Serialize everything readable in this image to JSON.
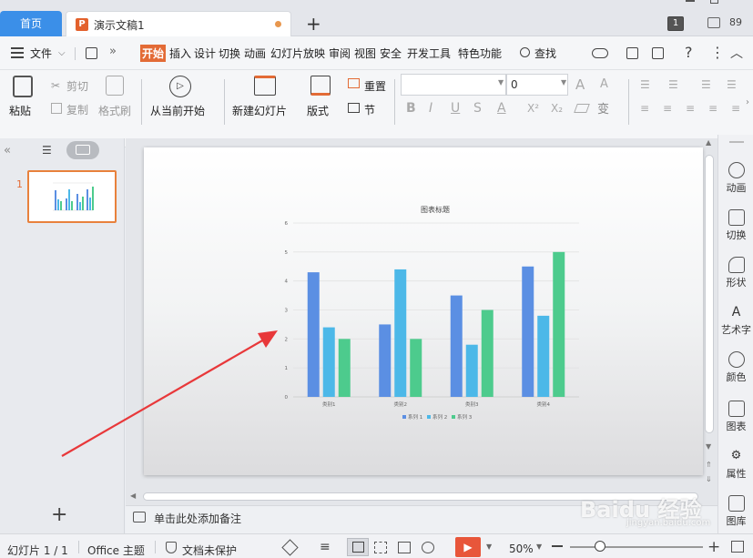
{
  "tabs": {
    "home": "首页",
    "doc": "演示文稿1",
    "new_tab": "+",
    "badge": "1",
    "count": "89"
  },
  "menu": {
    "file": "文件",
    "items": [
      "开始",
      "插入",
      "设计",
      "切换",
      "动画",
      "幻灯片放映",
      "审阅",
      "视图",
      "安全",
      "开发工具",
      "特色功能"
    ],
    "search": "查找"
  },
  "ribbon": {
    "paste": "粘贴",
    "cut": "剪切",
    "copy": "复制",
    "format_painter": "格式刷",
    "play_from_current": "从当前开始",
    "new_slide": "新建幻灯片",
    "layout": "版式",
    "reset": "重置",
    "section": "节",
    "font_size": "0"
  },
  "slides_panel": {
    "slide_number": "1"
  },
  "notes_placeholder": "单击此处添加备注",
  "right_panel": [
    "动画",
    "切换",
    "形状",
    "艺术字",
    "颜色",
    "图表",
    "属性",
    "图库"
  ],
  "status": {
    "slide_info": "幻灯片 1 / 1",
    "theme": "Office 主题",
    "protection": "文档未保护",
    "zoom": "50%"
  },
  "watermark": {
    "brand": "Baidu 经验",
    "url": "jingyan.baidu.com"
  },
  "colors": {
    "accent_orange": "#e36b36",
    "tab_blue": "#3b8fe8",
    "s1": "#5b8fe3",
    "s2": "#4cb8e8",
    "s3": "#4dcb8d",
    "arrow": "#e8383a"
  },
  "chart_data": {
    "type": "bar",
    "title": "图表标题",
    "categories": [
      "类别1",
      "类别2",
      "类别3",
      "类别4"
    ],
    "series": [
      {
        "name": "系列 1",
        "values": [
          4.3,
          2.5,
          3.5,
          4.5
        ]
      },
      {
        "name": "系列 2",
        "values": [
          2.4,
          4.4,
          1.8,
          2.8
        ]
      },
      {
        "name": "系列 3",
        "values": [
          2,
          2,
          3,
          5
        ]
      }
    ],
    "ylim": [
      0,
      6
    ],
    "yticks": [
      "0",
      "1",
      "2",
      "3",
      "4",
      "5",
      "6"
    ],
    "grid": true,
    "legend": "bottom"
  }
}
